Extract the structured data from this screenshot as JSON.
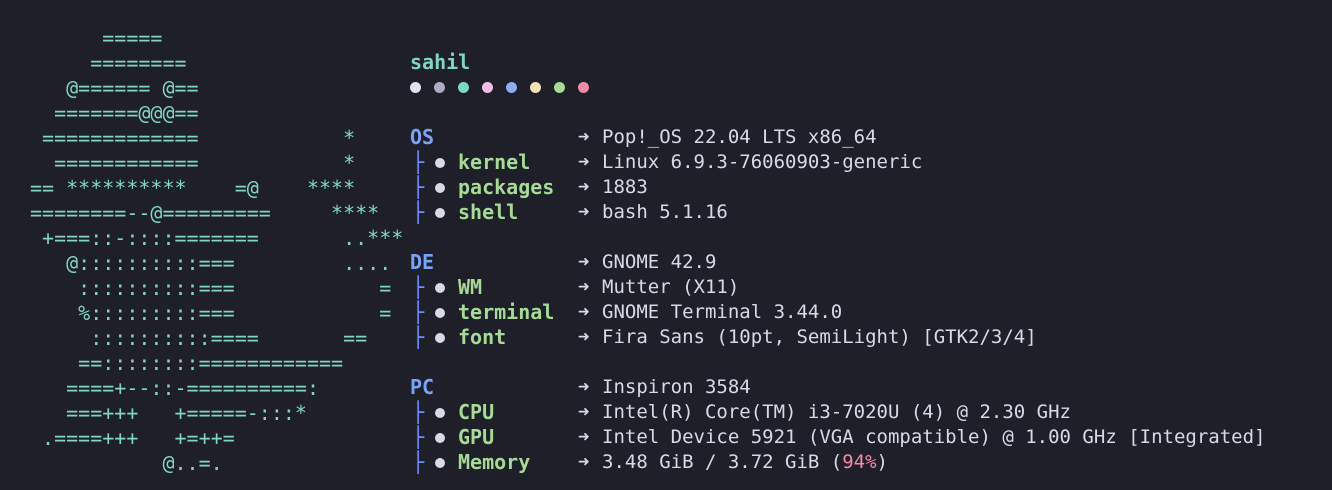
{
  "ascii_logo": "      =====\n     ========                   \n   @====== @==\n  =======@@@==\n =============            *\n  ============            *\n== **********    =@    ****\n========--@=========     ****\n +===::-::::=======       ..***\n   @::::::::::===         ....\n    ::::::::::===            =\n    %:::::::::===            =\n     ::::::::::====       ==\n    ==::::::::============\n   ====+--::-==========:\n   ===+++   +=====-:::*\n .====+++   +=++=\n           @..=.",
  "user": "sahil",
  "palette": [
    "#dfe3f0",
    "#a9adc1",
    "#7fd7c3",
    "#f5bde6",
    "#8aadf4",
    "#f5e0b4",
    "#a6da95",
    "#f38ba8"
  ],
  "arrow": "➜",
  "sections": [
    {
      "key": "OS",
      "value": "Pop!_OS 22.04 LTS x86_64",
      "items": [
        {
          "key": "kernel",
          "value": "Linux 6.9.3-76060903-generic"
        },
        {
          "key": "packages",
          "value": "1883"
        },
        {
          "key": "shell",
          "value": "bash 5.1.16"
        }
      ]
    },
    {
      "key": "DE",
      "value": "GNOME 42.9",
      "items": [
        {
          "key": "WM",
          "value": "Mutter (X11)"
        },
        {
          "key": "terminal",
          "value": "GNOME Terminal 3.44.0"
        },
        {
          "key": "font",
          "value": "Fira Sans (10pt, SemiLight) [GTK2/3/4]"
        }
      ]
    },
    {
      "key": "PC",
      "value": "Inspiron 3584",
      "items": [
        {
          "key": "CPU",
          "value": "Intel(R) Core(TM) i3-7020U (4) @ 2.30 GHz"
        },
        {
          "key": "GPU",
          "value": "Intel Device 5921 (VGA compatible) @ 1.00 GHz [Integrated]"
        },
        {
          "key": "Memory",
          "value_prefix": "3.48 GiB / 3.72 GiB (",
          "value_pct": "94%",
          "value_suffix": ")"
        }
      ]
    }
  ]
}
